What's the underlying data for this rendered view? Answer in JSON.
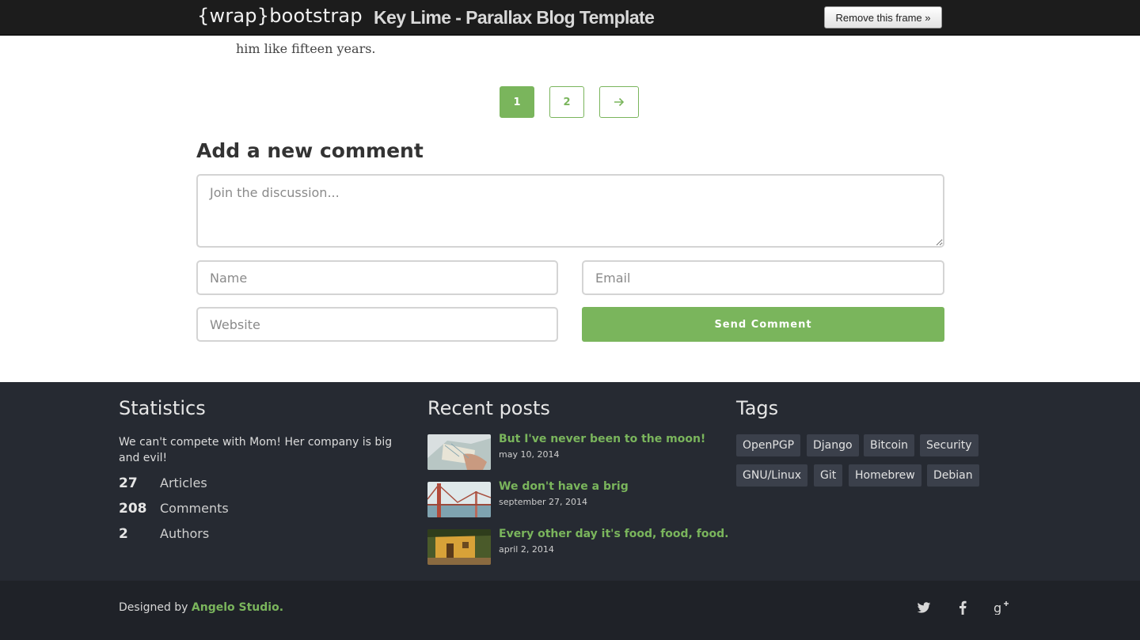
{
  "frame": {
    "brand_open": "{",
    "brand_wrap": "wrap",
    "brand_close": "}",
    "brand_name": "bootstrap",
    "title": "Key Lime - Parallax Blog Template",
    "remove_label": "Remove this frame »"
  },
  "article": {
    "tail_text": "him like fifteen years."
  },
  "pagination": {
    "pages": [
      "1",
      "2"
    ],
    "active": "1",
    "next_icon": "arrow-right-icon"
  },
  "comment_form": {
    "title": "Add a new comment",
    "message_placeholder": "Join the discussion...",
    "name_placeholder": "Name",
    "email_placeholder": "Email",
    "website_placeholder": "Website",
    "submit_label": "Send Comment"
  },
  "footer": {
    "statistics": {
      "title": "Statistics",
      "description": "We can't compete with Mom! Her company is big and evil!",
      "items": [
        {
          "value": "27",
          "label": "Articles"
        },
        {
          "value": "208",
          "label": "Comments"
        },
        {
          "value": "2",
          "label": "Authors"
        }
      ]
    },
    "recent_posts": {
      "title": "Recent posts",
      "items": [
        {
          "title": "But I've never been to the moon!",
          "date": "may 10, 2014"
        },
        {
          "title": "We don't have a brig",
          "date": "september 27, 2014"
        },
        {
          "title": "Every other day it's food, food, food.",
          "date": "april 2, 2014"
        }
      ]
    },
    "tags": {
      "title": "Tags",
      "items": [
        "OpenPGP",
        "Django",
        "Bitcoin",
        "Security",
        "GNU/Linux",
        "Git",
        "Homebrew",
        "Debian"
      ]
    }
  },
  "bottom": {
    "designed_by": "Designed by",
    "studio": "Angelo Studio.",
    "social": [
      "twitter-icon",
      "facebook-icon",
      "google-plus-icon"
    ]
  },
  "colors": {
    "accent": "#7ab55c",
    "footer_bg": "#262a32",
    "bottom_bg": "#1f2228",
    "topbar_bg": "#1c1c1c"
  }
}
